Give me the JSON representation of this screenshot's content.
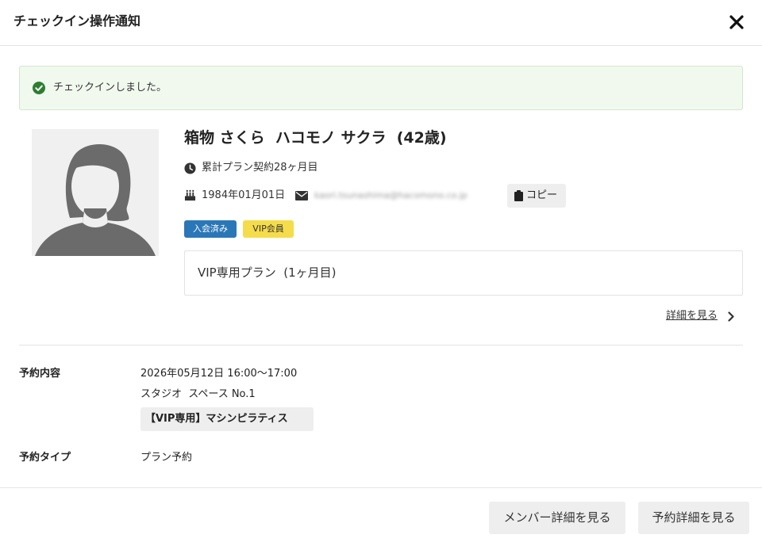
{
  "header": {
    "title": "チェックイン操作通知",
    "close_icon": "close-icon"
  },
  "alert": {
    "icon": "check-circle-icon",
    "message": "チェックインしました。",
    "color": "#2e7d32"
  },
  "member": {
    "avatar_icon": "female-avatar-icon",
    "name": "箱物 さくら  ハコモノ サクラ  (42歳)",
    "contract_icon": "clock-icon",
    "contract": "累計プラン契約28ヶ月目",
    "birthday_icon": "birthday-cake-icon",
    "birthday": "1984年01月01日",
    "email_icon": "envelope-icon",
    "email": "kaori.tsunashima@hacomono.co.jp",
    "copy_label": "コピー",
    "badges": {
      "joined": "入会済み",
      "vip": "VIP会員"
    },
    "plan": "VIP専用プラン  (1ヶ月目)",
    "detail_link": "詳細を見る"
  },
  "reservation": {
    "label": "予約内容",
    "datetime": "2026年05月12日 16:00〜17:00",
    "studio": "スタジオ  スペース No.1",
    "lesson": "【VIP専用】マシンピラティス",
    "type_label": "予約タイプ",
    "type_value": "プラン予約"
  },
  "footer": {
    "member_detail": "メンバー詳細を見る",
    "reservation_detail": "予約詳細を見る"
  },
  "colors": {
    "accent_blue": "#2a77b8",
    "vip_yellow": "#f5dc4a",
    "success_bg": "#f1f9ef"
  }
}
